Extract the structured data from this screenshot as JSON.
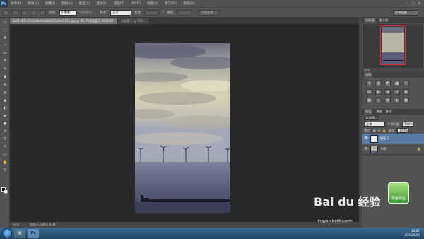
{
  "app": {
    "logo": "Ps",
    "window_buttons": [
      "–",
      "□",
      "×"
    ]
  },
  "menu": [
    "文件(F)",
    "编辑(E)",
    "图像(I)",
    "图层(L)",
    "类型(Y)",
    "选择(S)",
    "滤镜(T)",
    "3D(D)",
    "视图(V)",
    "窗口(W)",
    "帮助(H)"
  ],
  "options": {
    "feather_label": "羽化:",
    "feather_value": "0 像素",
    "antialias_label": "消除锯齿",
    "style_label": "样式:",
    "style_value": "正常",
    "width_label": "宽度:",
    "height_label": "高度:",
    "refine_button": "调整边缘...",
    "workspace": "基本功能"
  },
  "tabs": {
    "active": "2af0197b45e5d4bd9eb8b625c0ae512e.jpg @ 66.7% (图层 1, RGB/8#)",
    "inactive": "未标题-1 @ 50%..."
  },
  "tools": [
    "▭",
    "◌",
    "✥",
    "⌖",
    "✂",
    "⌗",
    "✎",
    "▮",
    "⊕",
    "◍",
    "▲",
    "◐",
    "▬",
    "●",
    "✍",
    "T",
    "↖",
    "▭",
    "✋",
    "⚲"
  ],
  "status": {
    "zoom": "50%",
    "doc": "文档:2.41M/2.41M"
  },
  "navigator": {
    "tabs": [
      "导航器",
      "直方图"
    ],
    "zoom": "50%"
  },
  "adjustments": {
    "title": "调整",
    "icons": [
      "☀",
      "▥",
      "◩",
      "◪",
      "▽",
      "▤",
      "◧",
      "◑",
      "◔",
      "▦",
      "▣",
      "◇",
      "▧",
      "◈",
      "▩"
    ]
  },
  "layers": {
    "tabs": [
      "图层",
      "通道",
      "路径"
    ],
    "kind": "ρ 类型",
    "blend_mode": "正常",
    "opacity_label": "不透明度:",
    "opacity_value": "100%",
    "lock_label": "锁定:",
    "fill_label": "填充:",
    "fill_value": "100%",
    "items": [
      {
        "name": "图层 1",
        "selected": true
      },
      {
        "name": "背景",
        "selected": false
      }
    ]
  },
  "watermark": {
    "brand": "Bai du 经验",
    "url": "jingyan.baidu.com",
    "badge": "百度经验"
  },
  "taskbar": {
    "time": "15:27",
    "date": "2016/4/23"
  },
  "colors": {
    "ui_dark": "#282828",
    "panel": "#535353",
    "accent_select": "#587aa2",
    "nav_red": "#e03030"
  }
}
